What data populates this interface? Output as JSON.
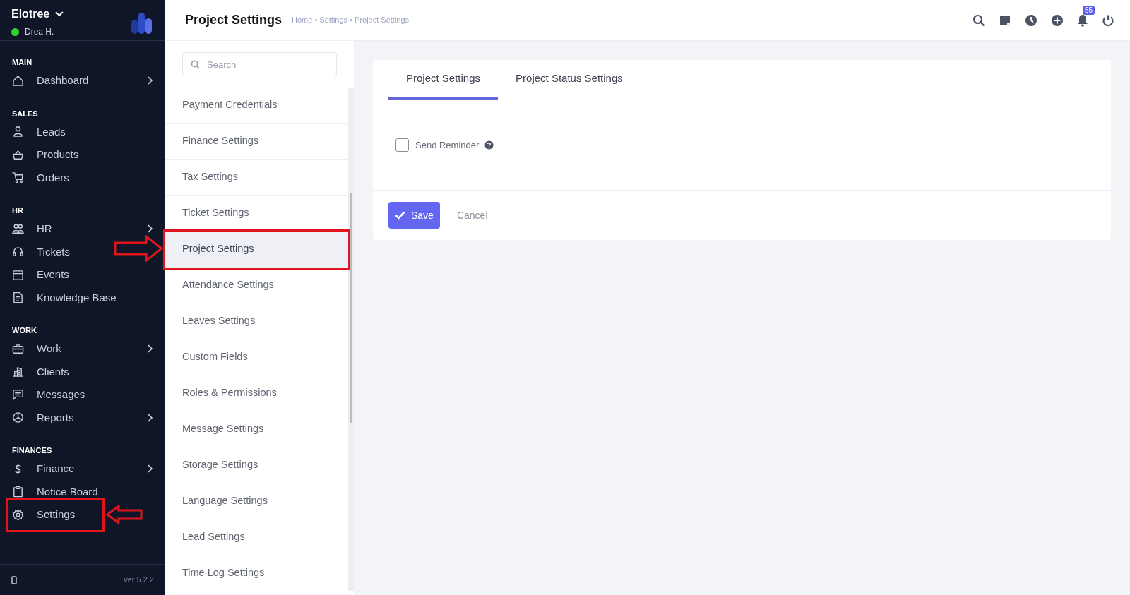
{
  "workspace": {
    "name": "Elotree",
    "user": "Drea H.",
    "online": true
  },
  "sidebar": {
    "sections": [
      {
        "title": "MAIN",
        "items": [
          {
            "label": "Dashboard",
            "submenu": true,
            "annotated": false
          }
        ]
      },
      {
        "title": "SALES",
        "items": [
          {
            "label": "Leads",
            "submenu": false,
            "annotated": false
          },
          {
            "label": "Products",
            "submenu": false,
            "annotated": false
          },
          {
            "label": "Orders",
            "submenu": false,
            "annotated": false
          }
        ]
      },
      {
        "title": "HR",
        "items": [
          {
            "label": "HR",
            "submenu": true,
            "annotated": false
          },
          {
            "label": "Tickets",
            "submenu": false,
            "annotated": false
          },
          {
            "label": "Events",
            "submenu": false,
            "annotated": false
          },
          {
            "label": "Knowledge Base",
            "submenu": false,
            "annotated": false
          }
        ]
      },
      {
        "title": "WORK",
        "items": [
          {
            "label": "Work",
            "submenu": true,
            "annotated": false
          },
          {
            "label": "Clients",
            "submenu": false,
            "annotated": false
          },
          {
            "label": "Messages",
            "submenu": false,
            "annotated": false
          },
          {
            "label": "Reports",
            "submenu": true,
            "annotated": false
          }
        ]
      },
      {
        "title": "FINANCES",
        "items": [
          {
            "label": "Finance",
            "submenu": true,
            "annotated": false
          },
          {
            "label": "Notice Board",
            "submenu": false,
            "annotated": false
          },
          {
            "label": "Settings",
            "submenu": false,
            "annotated": true
          }
        ]
      }
    ],
    "version": "ver 5.2.2"
  },
  "header": {
    "title": "Project Settings",
    "breadcrumb": "Home • Settings • Project Settings",
    "notification_count": "55"
  },
  "settings_menu": {
    "placeholder": "Search",
    "items": [
      {
        "label": "Payment Credentials",
        "selected": false,
        "annotated": false
      },
      {
        "label": "Finance Settings",
        "selected": false,
        "annotated": false
      },
      {
        "label": "Tax Settings",
        "selected": false,
        "annotated": false
      },
      {
        "label": "Ticket Settings",
        "selected": false,
        "annotated": false
      },
      {
        "label": "Project Settings",
        "selected": true,
        "annotated": true
      },
      {
        "label": "Attendance Settings",
        "selected": false,
        "annotated": false
      },
      {
        "label": "Leaves Settings",
        "selected": false,
        "annotated": false
      },
      {
        "label": "Custom Fields",
        "selected": false,
        "annotated": false
      },
      {
        "label": "Roles & Permissions",
        "selected": false,
        "annotated": false
      },
      {
        "label": "Message Settings",
        "selected": false,
        "annotated": false
      },
      {
        "label": "Storage Settings",
        "selected": false,
        "annotated": false
      },
      {
        "label": "Language Settings",
        "selected": false,
        "annotated": false
      },
      {
        "label": "Lead Settings",
        "selected": false,
        "annotated": false
      },
      {
        "label": "Time Log Settings",
        "selected": false,
        "annotated": false
      }
    ]
  },
  "tabs": [
    {
      "label": "Project Settings",
      "selected": true
    },
    {
      "label": "Project Status Settings",
      "selected": false
    }
  ],
  "form": {
    "send_reminder": {
      "label": "Send Reminder",
      "checked": false
    }
  },
  "buttons": {
    "save": "Save",
    "cancel": "Cancel"
  }
}
